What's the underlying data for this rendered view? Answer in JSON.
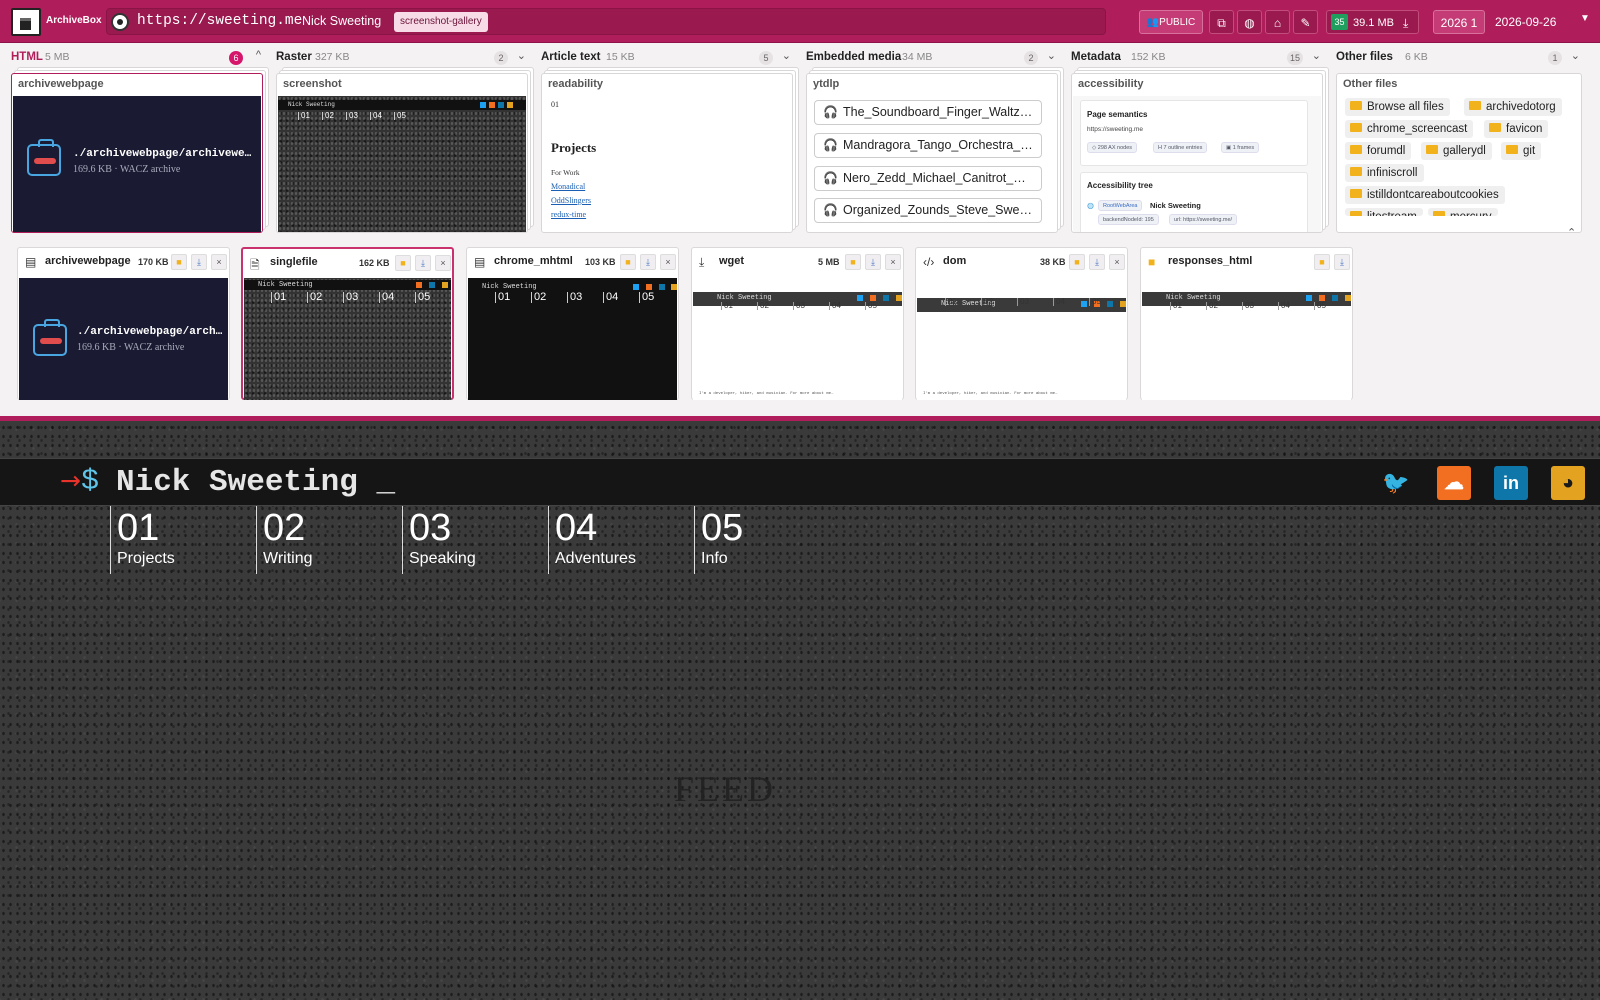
{
  "header": {
    "brand": "ArchiveBox",
    "url": "https://sweeting.me",
    "separator": "·",
    "page_title": "Nick Sweeting",
    "tag": "screenshot-gallery",
    "public_label": "👥PUBLIC",
    "count_badge": "35",
    "total_size": "39.1 MB",
    "year_label": "2026 1",
    "date": "2026-09-26"
  },
  "groups": [
    {
      "name": "HTML",
      "size": "5 MB",
      "count": "6",
      "stack_title": "archivewebpage",
      "chevron": "^"
    },
    {
      "name": "Raster",
      "size": "327 KB",
      "count": "2",
      "stack_title": "screenshot",
      "chevron": "⌄"
    },
    {
      "name": "Article text",
      "size": "15 KB",
      "count": "5",
      "stack_title": "readability",
      "chevron": "⌄"
    },
    {
      "name": "Embedded media",
      "size": "34 MB",
      "count": "2",
      "stack_title": "ytdlp",
      "chevron": "⌄"
    },
    {
      "name": "Metadata",
      "size": "152 KB",
      "count": "15",
      "stack_title": "accessibility",
      "chevron": "⌄"
    },
    {
      "name": "Other files",
      "size": "6 KB",
      "count": "1",
      "stack_title": "Other files",
      "chevron": "⌄"
    }
  ],
  "archive": {
    "path": "./archivewebpage/archivewebpage.wacz",
    "path_short": "./archivewebpage/arch…",
    "meta": "169.6 KB · WACZ archive"
  },
  "readability": {
    "num": "01",
    "heading": "Projects",
    "line1": "For Work",
    "links": [
      "Monadical",
      "OddSlingers",
      "redux-time"
    ]
  },
  "media_items": [
    "The_Soundboard_Finger_Waltz…",
    "Mandragora_Tango_Orchestra_…",
    "Nero_Zedd_Michael_Canitrot_…",
    "Organized_Zounds_Steve_Swe…"
  ],
  "accessibility": {
    "sem_title": "Page semantics",
    "sem_url": "https://sweeting.me",
    "pills": [
      "◇ 298 AX nodes",
      "H 7 outline entries",
      "▣ 1 frames"
    ],
    "tree_title": "Accessibility tree",
    "root_label": "RootWebArea",
    "root_name": "Nick Sweeting",
    "tree_sub1": "backendNodeId: 195",
    "tree_sub2": "url: https://sweeting.me/"
  },
  "other_files": [
    "Browse all files",
    "archivedotorg",
    "chrome_screencast",
    "favicon",
    "forumdl",
    "gallerydl",
    "git",
    "infiniscroll",
    "istilldontcareaboutcookies",
    "litestream",
    "mercury"
  ],
  "cards": [
    {
      "name": "archivewebpage",
      "size": "170 KB",
      "icon": "archive-icon"
    },
    {
      "name": "singlefile",
      "size": "162 KB",
      "icon": "file-icon"
    },
    {
      "name": "chrome_mhtml",
      "size": "103 KB",
      "icon": "doc-icon"
    },
    {
      "name": "wget",
      "size": "5 MB",
      "icon": "download-icon"
    },
    {
      "name": "dom",
      "size": "38 KB",
      "icon": "code-icon"
    },
    {
      "name": "responses_html",
      "size": "",
      "icon": "folder-icon"
    }
  ],
  "mini_site": {
    "name": "Nick Sweeting",
    "caption": "I'm a developer, hiker, and musician. For more about me…"
  },
  "site": {
    "prompt_arrow": "→",
    "prompt_dollar": "$",
    "name": "Nick Sweeting _",
    "nav": [
      {
        "num": "01",
        "label": "Projects"
      },
      {
        "num": "02",
        "label": "Writing"
      },
      {
        "num": "03",
        "label": "Speaking"
      },
      {
        "num": "04",
        "label": "Adventures"
      },
      {
        "num": "05",
        "label": "Info"
      }
    ],
    "feed_text": "FEED",
    "social": [
      "twitter-icon",
      "soundcloud-icon",
      "linkedin-icon",
      "github-icon"
    ]
  },
  "colors": {
    "brand": "#b01d5b",
    "accent_pink": "#d5166b",
    "archive_dark": "#1a1b33",
    "twitter": "#1da1f2",
    "soundcloud": "#f26f21",
    "linkedin": "#0e76a8",
    "github": "#e3a320"
  }
}
